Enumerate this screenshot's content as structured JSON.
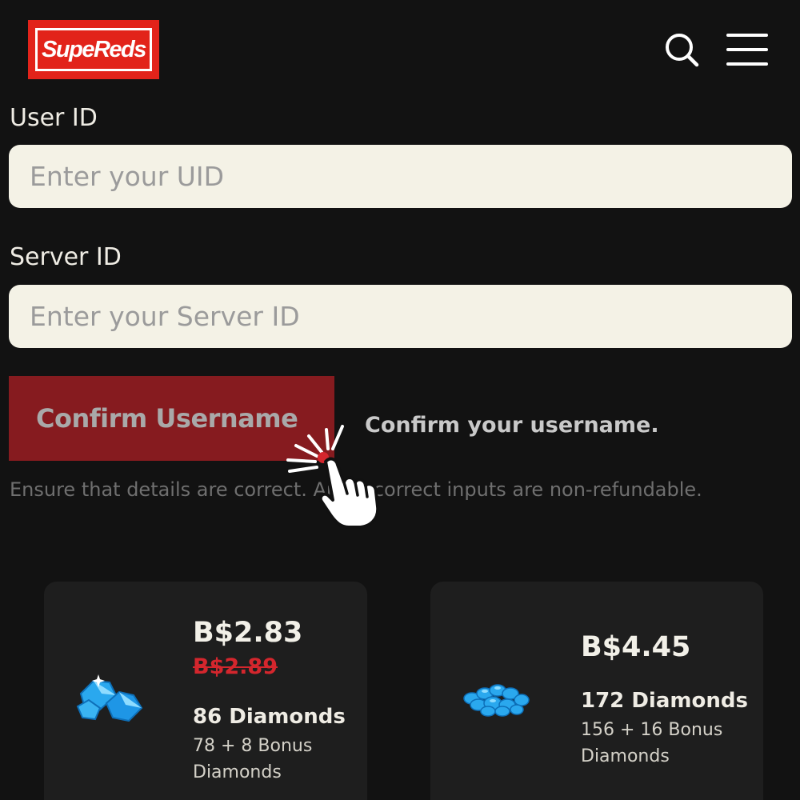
{
  "brand": {
    "logo_text": "SupeReds"
  },
  "header": {
    "search_icon": "search-icon",
    "menu_icon": "hamburger-menu-icon"
  },
  "form": {
    "user_id": {
      "label": "User ID",
      "placeholder": "Enter your UID",
      "value": ""
    },
    "server_id": {
      "label": "Server ID",
      "placeholder": "Enter your Server ID",
      "value": ""
    },
    "confirm_button": "Confirm Username",
    "confirm_hint": "Confirm your username.",
    "notice": "Ensure that details are correct. Any incorrect inputs are non-refundable."
  },
  "packages": [
    {
      "price": "B$2.83",
      "old_price": "B$2.89",
      "amount": "86 Diamonds",
      "bonus": "78 + 8 Bonus Diamonds",
      "icon": "diamond-pile-small-icon"
    },
    {
      "price": "B$4.45",
      "old_price": "",
      "amount": "172 Diamonds",
      "bonus": "156 + 16 Bonus Diamonds",
      "icon": "diamond-pile-medium-icon"
    }
  ],
  "colors": {
    "background": "#121212",
    "brand_red": "#e2231a",
    "button_red": "#861b1f",
    "field_bg": "#f4f2e6",
    "strike_red": "#d4262d",
    "card_bg": "#1e1e1e"
  }
}
